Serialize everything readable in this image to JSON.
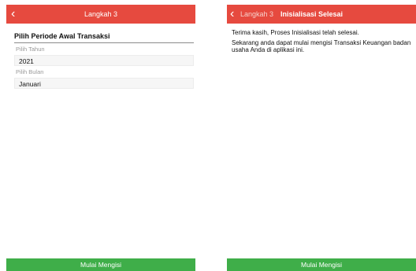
{
  "colors": {
    "header": "#e64a3f",
    "button": "#3fae49"
  },
  "left": {
    "header": {
      "back_icon": "chevron-left-icon",
      "back_glyph": "‹",
      "title": "Langkah 3"
    },
    "section_title": "Pilih Periode Awal Transaksi",
    "year": {
      "label": "Pilih Tahun",
      "value": "2021"
    },
    "month": {
      "label": "Pilih Bulan",
      "value": "Januari"
    },
    "start_button": "Mulai Mengisi"
  },
  "right": {
    "header": {
      "back_icon": "chevron-left-icon",
      "back_glyph": "‹",
      "back_label": "Langkah 3",
      "title": "Inisialisasi Selesai"
    },
    "message_1": "Terima kasih, Proses Inisialisasi telah selesai.",
    "message_2": "Sekarang anda dapat mulai mengisi Transaksi Keuangan badan usaha Anda di aplikasi ini.",
    "start_button": "Mulai Mengisi"
  }
}
